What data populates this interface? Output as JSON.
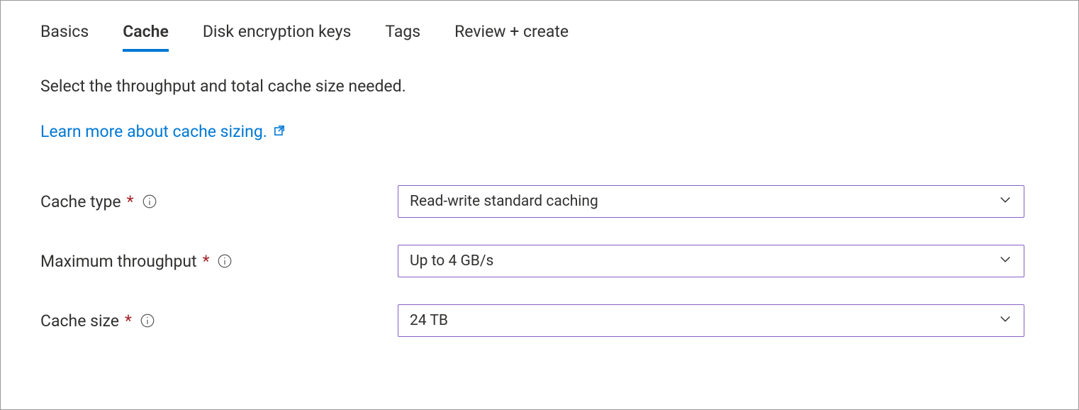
{
  "tabs": {
    "basics": "Basics",
    "cache": "Cache",
    "disk_encryption_keys": "Disk encryption keys",
    "tags": "Tags",
    "review_create": "Review + create"
  },
  "description": "Select the throughput and total cache size needed.",
  "learn_more": "Learn more about cache sizing.",
  "fields": {
    "cache_type": {
      "label": "Cache type",
      "value": "Read-write standard caching"
    },
    "max_throughput": {
      "label": "Maximum throughput",
      "value": "Up to 4 GB/s"
    },
    "cache_size": {
      "label": "Cache size",
      "value": "24 TB"
    }
  },
  "required_marker": "*"
}
